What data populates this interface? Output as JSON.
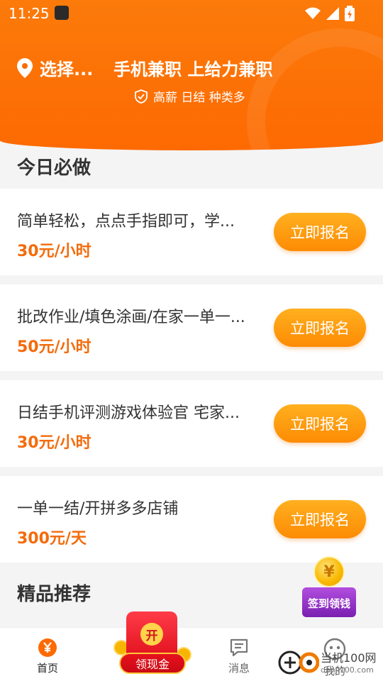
{
  "status_bar": {
    "time": "11:25"
  },
  "header": {
    "location_label": "选择...",
    "slogan": "手机兼职 上给力兼职",
    "subtitle": "高薪 日结 种类多"
  },
  "today_section": {
    "title": "今日必做"
  },
  "jobs": [
    {
      "title": "简单轻松，点点手指即可，学...",
      "price": "30元/小时",
      "button": "立即报名"
    },
    {
      "title": "批改作业/填色涂画/在家一单一...",
      "price": "50元/小时",
      "button": "立即报名"
    },
    {
      "title": "日结手机评测游戏体验官 宅家...",
      "price": "30元/小时",
      "button": "立即报名"
    },
    {
      "title": "一单一结/开拼多多店铺",
      "price": "300元/天",
      "button": "立即报名"
    }
  ],
  "featured_section": {
    "title": "精品推荐"
  },
  "signin": {
    "coin_symbol": "¥",
    "label": "签到领钱"
  },
  "redpacket": {
    "open_label": "开",
    "cash_label": "领现金"
  },
  "tabs": [
    {
      "label": "首页",
      "icon": "yen-home-icon",
      "active": true
    },
    {
      "label": "消息",
      "icon": "message-icon",
      "active": false
    },
    {
      "label": "我的",
      "icon": "profile-icon",
      "active": false
    }
  ],
  "watermark": {
    "line1": "当机100网",
    "line2": "danji100.com"
  },
  "colors": {
    "primary": "#fd6a02",
    "price": "#f46b0b",
    "button": "#fd8b04"
  }
}
